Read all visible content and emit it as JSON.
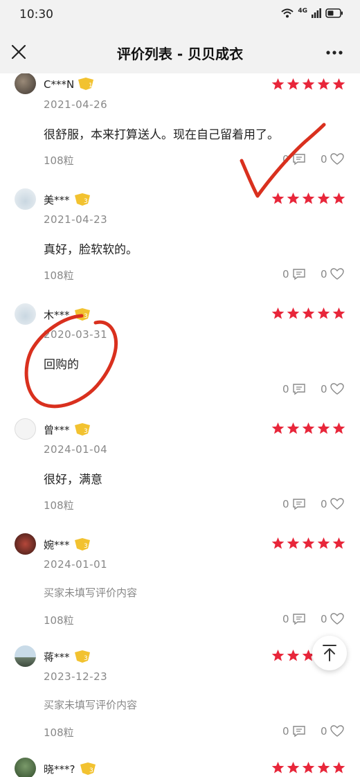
{
  "status_bar": {
    "time": "10:30",
    "network": "4G"
  },
  "header": {
    "title": "评价列表 - 贝贝成衣"
  },
  "colors": {
    "star": "#e8263a",
    "badge": "#f2c230",
    "annotation": "#d9301e"
  },
  "reviews": [
    {
      "user": "C***N",
      "level": "1",
      "rating": 5,
      "date": "2021-04-26",
      "content": "很舒服，本来打算送人。现在自己留着用了。",
      "points": "108粒",
      "comments": "0",
      "likes": "0"
    },
    {
      "user": "美***",
      "level": "3",
      "rating": 5,
      "date": "2021-04-23",
      "content": "真好，脸软软的。",
      "points": "108粒",
      "comments": "0",
      "likes": "0"
    },
    {
      "user": "木***",
      "level": "3",
      "rating": 5,
      "date": "2020-03-31",
      "content": "回购的",
      "points": "",
      "comments": "0",
      "likes": "0"
    },
    {
      "user": "曾***",
      "level": "3",
      "rating": 5,
      "date": "2024-01-04",
      "content": "很好，满意",
      "points": "108粒",
      "comments": "0",
      "likes": "0"
    },
    {
      "user": "婉***",
      "level": "3",
      "rating": 5,
      "date": "2024-01-01",
      "content": "买家未填写评价内容",
      "points": "108粒",
      "comments": "0",
      "likes": "0"
    },
    {
      "user": "蒋***",
      "level": "3",
      "rating": 5,
      "date": "2023-12-23",
      "content": "买家未填写评价内容",
      "points": "108粒",
      "comments": "0",
      "likes": "0"
    },
    {
      "user": "晓***?",
      "level": "3",
      "rating": 5,
      "date": "",
      "content": "",
      "points": "",
      "comments": "",
      "likes": ""
    }
  ]
}
